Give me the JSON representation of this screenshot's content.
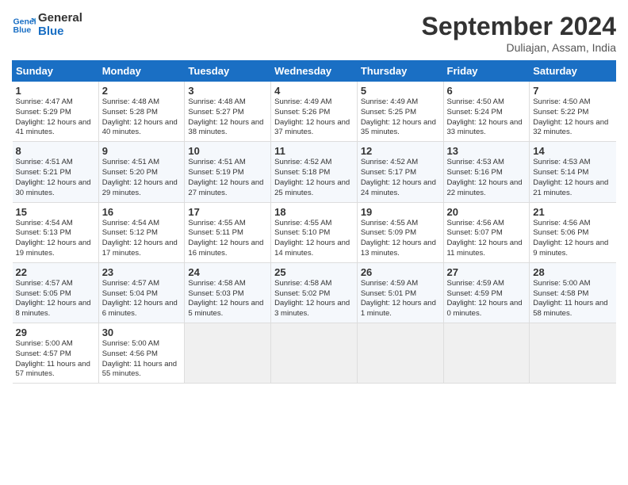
{
  "logo": {
    "line1": "General",
    "line2": "Blue"
  },
  "title": "September 2024",
  "location": "Duliajan, Assam, India",
  "headers": [
    "Sunday",
    "Monday",
    "Tuesday",
    "Wednesday",
    "Thursday",
    "Friday",
    "Saturday"
  ],
  "weeks": [
    [
      {
        "day": "1",
        "sunrise": "4:47 AM",
        "sunset": "5:29 PM",
        "daylight": "12 hours and 41 minutes."
      },
      {
        "day": "2",
        "sunrise": "4:48 AM",
        "sunset": "5:28 PM",
        "daylight": "12 hours and 40 minutes."
      },
      {
        "day": "3",
        "sunrise": "4:48 AM",
        "sunset": "5:27 PM",
        "daylight": "12 hours and 38 minutes."
      },
      {
        "day": "4",
        "sunrise": "4:49 AM",
        "sunset": "5:26 PM",
        "daylight": "12 hours and 37 minutes."
      },
      {
        "day": "5",
        "sunrise": "4:49 AM",
        "sunset": "5:25 PM",
        "daylight": "12 hours and 35 minutes."
      },
      {
        "day": "6",
        "sunrise": "4:50 AM",
        "sunset": "5:24 PM",
        "daylight": "12 hours and 33 minutes."
      },
      {
        "day": "7",
        "sunrise": "4:50 AM",
        "sunset": "5:22 PM",
        "daylight": "12 hours and 32 minutes."
      }
    ],
    [
      {
        "day": "8",
        "sunrise": "4:51 AM",
        "sunset": "5:21 PM",
        "daylight": "12 hours and 30 minutes."
      },
      {
        "day": "9",
        "sunrise": "4:51 AM",
        "sunset": "5:20 PM",
        "daylight": "12 hours and 29 minutes."
      },
      {
        "day": "10",
        "sunrise": "4:51 AM",
        "sunset": "5:19 PM",
        "daylight": "12 hours and 27 minutes."
      },
      {
        "day": "11",
        "sunrise": "4:52 AM",
        "sunset": "5:18 PM",
        "daylight": "12 hours and 25 minutes."
      },
      {
        "day": "12",
        "sunrise": "4:52 AM",
        "sunset": "5:17 PM",
        "daylight": "12 hours and 24 minutes."
      },
      {
        "day": "13",
        "sunrise": "4:53 AM",
        "sunset": "5:16 PM",
        "daylight": "12 hours and 22 minutes."
      },
      {
        "day": "14",
        "sunrise": "4:53 AM",
        "sunset": "5:14 PM",
        "daylight": "12 hours and 21 minutes."
      }
    ],
    [
      {
        "day": "15",
        "sunrise": "4:54 AM",
        "sunset": "5:13 PM",
        "daylight": "12 hours and 19 minutes."
      },
      {
        "day": "16",
        "sunrise": "4:54 AM",
        "sunset": "5:12 PM",
        "daylight": "12 hours and 17 minutes."
      },
      {
        "day": "17",
        "sunrise": "4:55 AM",
        "sunset": "5:11 PM",
        "daylight": "12 hours and 16 minutes."
      },
      {
        "day": "18",
        "sunrise": "4:55 AM",
        "sunset": "5:10 PM",
        "daylight": "12 hours and 14 minutes."
      },
      {
        "day": "19",
        "sunrise": "4:55 AM",
        "sunset": "5:09 PM",
        "daylight": "12 hours and 13 minutes."
      },
      {
        "day": "20",
        "sunrise": "4:56 AM",
        "sunset": "5:07 PM",
        "daylight": "12 hours and 11 minutes."
      },
      {
        "day": "21",
        "sunrise": "4:56 AM",
        "sunset": "5:06 PM",
        "daylight": "12 hours and 9 minutes."
      }
    ],
    [
      {
        "day": "22",
        "sunrise": "4:57 AM",
        "sunset": "5:05 PM",
        "daylight": "12 hours and 8 minutes."
      },
      {
        "day": "23",
        "sunrise": "4:57 AM",
        "sunset": "5:04 PM",
        "daylight": "12 hours and 6 minutes."
      },
      {
        "day": "24",
        "sunrise": "4:58 AM",
        "sunset": "5:03 PM",
        "daylight": "12 hours and 5 minutes."
      },
      {
        "day": "25",
        "sunrise": "4:58 AM",
        "sunset": "5:02 PM",
        "daylight": "12 hours and 3 minutes."
      },
      {
        "day": "26",
        "sunrise": "4:59 AM",
        "sunset": "5:01 PM",
        "daylight": "12 hours and 1 minute."
      },
      {
        "day": "27",
        "sunrise": "4:59 AM",
        "sunset": "4:59 PM",
        "daylight": "12 hours and 0 minutes."
      },
      {
        "day": "28",
        "sunrise": "5:00 AM",
        "sunset": "4:58 PM",
        "daylight": "11 hours and 58 minutes."
      }
    ],
    [
      {
        "day": "29",
        "sunrise": "5:00 AM",
        "sunset": "4:57 PM",
        "daylight": "11 hours and 57 minutes."
      },
      {
        "day": "30",
        "sunrise": "5:00 AM",
        "sunset": "4:56 PM",
        "daylight": "11 hours and 55 minutes."
      },
      {
        "day": "",
        "sunrise": "",
        "sunset": "",
        "daylight": ""
      },
      {
        "day": "",
        "sunrise": "",
        "sunset": "",
        "daylight": ""
      },
      {
        "day": "",
        "sunrise": "",
        "sunset": "",
        "daylight": ""
      },
      {
        "day": "",
        "sunrise": "",
        "sunset": "",
        "daylight": ""
      },
      {
        "day": "",
        "sunrise": "",
        "sunset": "",
        "daylight": ""
      }
    ]
  ]
}
